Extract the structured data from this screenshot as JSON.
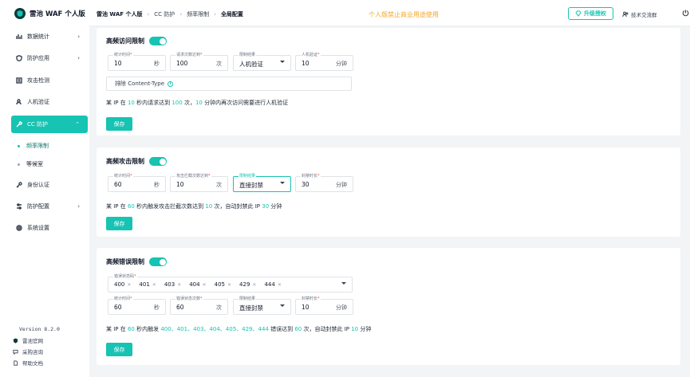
{
  "brand": {
    "name": "雷池 WAF 个人版"
  },
  "sidebar": {
    "items": [
      {
        "label": "数据统计",
        "icon": "bar-chart-icon",
        "chevron": "›"
      },
      {
        "label": "防护应用",
        "icon": "shield-icon",
        "chevron": "›"
      },
      {
        "label": "攻击检测",
        "icon": "list-icon"
      },
      {
        "label": "人机验证",
        "icon": "user-check-icon"
      },
      {
        "label": "CC 防护",
        "icon": "wrench-icon",
        "chevron": "⌃"
      },
      {
        "label": "身份认证",
        "icon": "key-icon"
      },
      {
        "label": "防护配置",
        "icon": "sliders-icon",
        "chevron": "›"
      },
      {
        "label": "系统设置",
        "icon": "gear-icon"
      }
    ],
    "subitems": [
      {
        "label": "频率限制"
      },
      {
        "label": "等候室"
      }
    ],
    "version": "Version 8.2.0",
    "footer": [
      {
        "label": "雷池官网",
        "icon": "shield-logo-icon"
      },
      {
        "label": "采购咨询",
        "icon": "chat-icon"
      },
      {
        "label": "帮助文档",
        "icon": "doc-icon"
      }
    ]
  },
  "topbar": {
    "breadcrumb": [
      "雷池 WAF 个人版",
      "CC 防护",
      "频率限制",
      "全局配置"
    ],
    "notice": "个人版禁止商业用途使用",
    "upgrade_label": "升级授权",
    "group_label": "技术交流群"
  },
  "accent_color": "#17c3b2",
  "cards": {
    "access": {
      "title": "高频访问限制",
      "enabled": true,
      "fields": [
        {
          "label": "统计时间",
          "value": "10",
          "unit": "秒"
        },
        {
          "label": "请求次数达到",
          "value": "100",
          "unit": "次"
        },
        {
          "label": "限制结果",
          "value": "人机验证"
        },
        {
          "label": "人机验证",
          "value": "10",
          "unit": "分钟"
        }
      ],
      "exclude_label": "排除 Content-Type",
      "desc": {
        "p1": "某 IP 在 ",
        "n1": "10",
        "p2": " 秒内请求达到 ",
        "n2": "100",
        "p3": " 次，",
        "n3": "10",
        "p4": " 分钟内再次访问需要进行人机验证"
      },
      "save_label": "保存"
    },
    "attack": {
      "title": "高频攻击限制",
      "enabled": true,
      "fields": [
        {
          "label": "统计时间",
          "value": "60",
          "unit": "秒"
        },
        {
          "label": "攻击拦截次数达到",
          "value": "10",
          "unit": "次"
        },
        {
          "label": "限制结果",
          "value": "直接封禁"
        },
        {
          "label": "封禁时长",
          "value": "30",
          "unit": "分钟"
        }
      ],
      "desc": {
        "p1": "某 IP 在 ",
        "n1": "60",
        "p2": " 秒内触发攻击拦截次数达到 ",
        "n2": "10",
        "p3": " 次，自动封禁此 IP ",
        "n3": "30",
        "p4": " 分钟"
      },
      "save_label": "保存"
    },
    "error": {
      "title": "高频错误限制",
      "enabled": true,
      "status_label": "错误状态码",
      "codes": [
        "400",
        "401",
        "403",
        "404",
        "405",
        "429",
        "444"
      ],
      "fields": [
        {
          "label": "统计时间",
          "value": "60",
          "unit": "秒"
        },
        {
          "label": "错误状态次数",
          "value": "60",
          "unit": "次"
        },
        {
          "label": "限制结果",
          "value": "直接封禁"
        },
        {
          "label": "封禁时长",
          "value": "10",
          "unit": "分钟"
        }
      ],
      "desc": {
        "p1": "某 IP 在 ",
        "n1": "60",
        "p2": " 秒内触发 ",
        "n2": "400、401、403、404、405、429、444",
        "p3": " 错误达到 ",
        "n3": "60",
        "p4": " 次，自动封禁此 IP ",
        "n4": "10",
        "p5": " 分钟"
      },
      "save_label": "保存"
    }
  }
}
